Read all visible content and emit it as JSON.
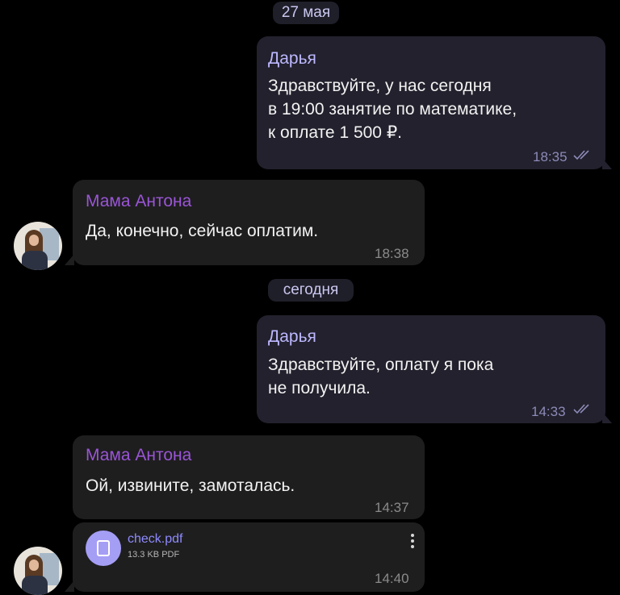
{
  "dates": {
    "first": "27 мая",
    "second": "сегодня"
  },
  "messages": [
    {
      "sender": "Дарья",
      "text": "Здравствуйте, у нас сегодня\nв 19:00 занятие по математике,\nк оплате 1 500 ₽.",
      "time": "18:35",
      "read": true
    },
    {
      "sender": "Мама Антона",
      "text": "Да, конечно, сейчас оплатим.",
      "time": "18:38"
    },
    {
      "sender": "Дарья",
      "text": "Здравствуйте, оплату я пока\nне получила.",
      "time": "14:33",
      "read": true
    },
    {
      "sender": "Мама Антона",
      "text": "Ой, извините, замоталась.",
      "time": "14:37"
    }
  ],
  "attachment": {
    "file_name": "check.pdf",
    "file_size": "13.3 KB PDF",
    "time": "14:40",
    "icon": "file-icon"
  },
  "colors": {
    "outgoing_bubble": "#22212d",
    "incoming_bubble": "#1e1e1e",
    "outgoing_name": "#bdb8ff",
    "incoming_name": "#9a55d6",
    "file_accent": "#a59ef5"
  }
}
